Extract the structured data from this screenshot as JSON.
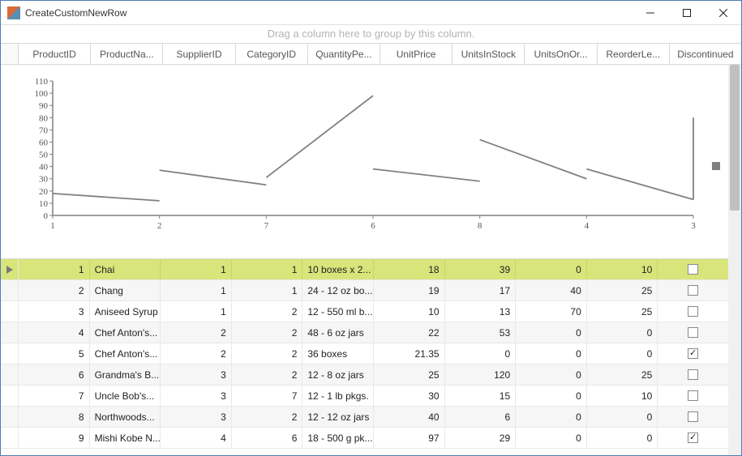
{
  "window": {
    "title": "CreateCustomNewRow"
  },
  "groupPanel": {
    "text": "Drag a column here to group by this column."
  },
  "columns": {
    "c0": "ProductID",
    "c1": "ProductNa...",
    "c2": "SupplierID",
    "c3": "CategoryID",
    "c4": "QuantityPe...",
    "c5": "UnitPrice",
    "c6": "UnitsInStock",
    "c7": "UnitsOnOr...",
    "c8": "ReorderLe...",
    "c9": "Discontinued"
  },
  "chart_data": {
    "type": "line",
    "x_categories": [
      "1",
      "2",
      "7",
      "6",
      "8",
      "4",
      "3"
    ],
    "y_ticks": [
      0,
      10,
      20,
      30,
      40,
      50,
      60,
      70,
      80,
      90,
      100,
      110
    ],
    "ylim": [
      0,
      110
    ],
    "series": [
      {
        "name": "",
        "segments": [
          [
            [
              0,
              18
            ],
            [
              1,
              12
            ]
          ],
          [
            [
              1,
              37
            ],
            [
              2,
              25
            ]
          ],
          [
            [
              2,
              31
            ],
            [
              3,
              98
            ]
          ],
          [
            [
              3,
              38
            ],
            [
              4,
              28
            ]
          ],
          [
            [
              4,
              62
            ],
            [
              5,
              30
            ]
          ],
          [
            [
              5,
              38
            ],
            [
              6,
              13
            ]
          ],
          [
            [
              6,
              13
            ],
            [
              6,
              80
            ]
          ]
        ]
      }
    ]
  },
  "rows": {
    "r0": {
      "ProductID": "1",
      "ProductName": "Chai",
      "SupplierID": "1",
      "CategoryID": "1",
      "QuantityPerUnit": "10 boxes x 2...",
      "UnitPrice": "18",
      "UnitsInStock": "39",
      "UnitsOnOrder": "0",
      "ReorderLevel": "10",
      "DiscTxt": ""
    },
    "r1": {
      "ProductID": "2",
      "ProductName": "Chang",
      "SupplierID": "1",
      "CategoryID": "1",
      "QuantityPerUnit": "24 - 12 oz bo...",
      "UnitPrice": "19",
      "UnitsInStock": "17",
      "UnitsOnOrder": "40",
      "ReorderLevel": "25",
      "DiscTxt": ""
    },
    "r2": {
      "ProductID": "3",
      "ProductName": "Aniseed Syrup",
      "SupplierID": "1",
      "CategoryID": "2",
      "QuantityPerUnit": "12 - 550 ml b...",
      "UnitPrice": "10",
      "UnitsInStock": "13",
      "UnitsOnOrder": "70",
      "ReorderLevel": "25",
      "DiscTxt": ""
    },
    "r3": {
      "ProductID": "4",
      "ProductName": "Chef Anton's...",
      "SupplierID": "2",
      "CategoryID": "2",
      "QuantityPerUnit": "48 - 6 oz jars",
      "UnitPrice": "22",
      "UnitsInStock": "53",
      "UnitsOnOrder": "0",
      "ReorderLevel": "0",
      "DiscTxt": ""
    },
    "r4": {
      "ProductID": "5",
      "ProductName": "Chef Anton's...",
      "SupplierID": "2",
      "CategoryID": "2",
      "QuantityPerUnit": "36 boxes",
      "UnitPrice": "21.35",
      "UnitsInStock": "0",
      "UnitsOnOrder": "0",
      "ReorderLevel": "0",
      "DiscTxt": "✓"
    },
    "r5": {
      "ProductID": "6",
      "ProductName": "Grandma's  B...",
      "SupplierID": "3",
      "CategoryID": "2",
      "QuantityPerUnit": "12 - 8 oz jars",
      "UnitPrice": "25",
      "UnitsInStock": "120",
      "UnitsOnOrder": "0",
      "ReorderLevel": "25",
      "DiscTxt": ""
    },
    "r6": {
      "ProductID": "7",
      "ProductName": "Uncle Bob's...",
      "SupplierID": "3",
      "CategoryID": "7",
      "QuantityPerUnit": "12 - 1 lb pkgs.",
      "UnitPrice": "30",
      "UnitsInStock": "15",
      "UnitsOnOrder": "0",
      "ReorderLevel": "10",
      "DiscTxt": ""
    },
    "r7": {
      "ProductID": "8",
      "ProductName": "Northwoods...",
      "SupplierID": "3",
      "CategoryID": "2",
      "QuantityPerUnit": "12 - 12 oz jars",
      "UnitPrice": "40",
      "UnitsInStock": "6",
      "UnitsOnOrder": "0",
      "ReorderLevel": "0",
      "DiscTxt": ""
    },
    "r8": {
      "ProductID": "9",
      "ProductName": "Mishi Kobe N...",
      "SupplierID": "4",
      "CategoryID": "6",
      "QuantityPerUnit": "18 - 500 g pk...",
      "UnitPrice": "97",
      "UnitsInStock": "29",
      "UnitsOnOrder": "0",
      "ReorderLevel": "0",
      "DiscTxt": "✓"
    }
  }
}
